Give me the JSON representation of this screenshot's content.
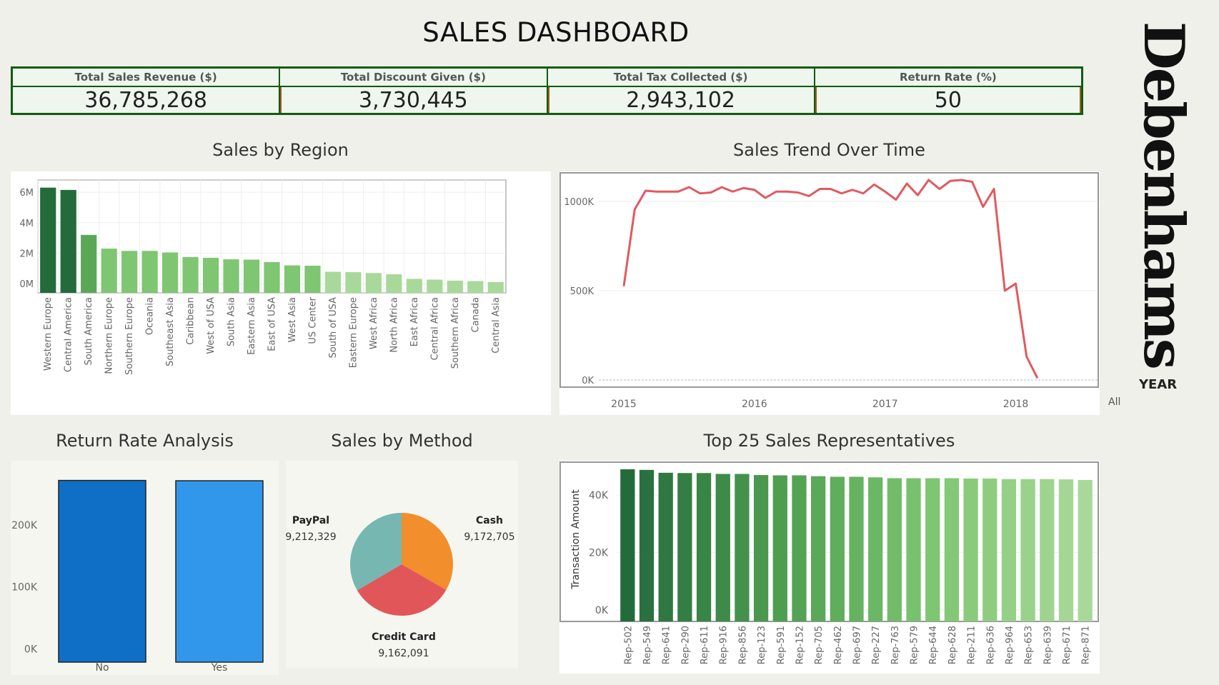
{
  "dashboard": {
    "title": "SALES DASHBOARD"
  },
  "brand": {
    "name": "Debenhams"
  },
  "filter": {
    "label": "YEAR",
    "value": "All"
  },
  "kpis": [
    {
      "label": "Total Sales Revenue ($)",
      "value": "36,785,268"
    },
    {
      "label": "Total Discount Given ($)",
      "value": "3,730,445"
    },
    {
      "label": "Total Tax Collected ($)",
      "value": "2,943,102"
    },
    {
      "label": "Return Rate (%)",
      "value": "50"
    }
  ],
  "colors": {
    "green_dark": "#246b3c",
    "green_mid": "#5aa855",
    "green_light": "#7ec671",
    "green_pale": "#a9d99a",
    "line_red": "#e05a5f",
    "blue_dark": "#0f6fc6",
    "blue_light": "#3197ea",
    "pie_orange": "#f28e2b",
    "pie_red": "#e15759",
    "pie_teal": "#76b7b2"
  },
  "chart_data": [
    {
      "id": "sales_by_region",
      "type": "bar",
      "title": "Sales by Region",
      "xlabel": "",
      "ylabel": "",
      "categories": [
        "Western Europe",
        "Central America",
        "South America",
        "Northern Europe",
        "Southern Europe",
        "Oceania",
        "Southeast Asia",
        "Caribbean",
        "West of USA",
        "South Asia",
        "Eastern Asia",
        "East of USA",
        "West Asia",
        "US Center",
        "South of USA",
        "Eastern Europe",
        "West Africa",
        "North Africa",
        "East Africa",
        "Central Africa",
        "Southern Africa",
        "Canada",
        "Central Asia"
      ],
      "values": [
        6300000,
        6150000,
        3200000,
        2300000,
        2150000,
        2150000,
        2050000,
        1750000,
        1700000,
        1600000,
        1580000,
        1420000,
        1200000,
        1180000,
        780000,
        760000,
        700000,
        620000,
        320000,
        270000,
        200000,
        170000,
        110000
      ],
      "ylim": [
        -600000,
        6800000
      ],
      "yticks": [
        0,
        2000000,
        4000000,
        6000000
      ],
      "ytick_labels": [
        "0M",
        "2M",
        "4M",
        "6M"
      ],
      "grid": true
    },
    {
      "id": "sales_trend",
      "type": "line",
      "title": "Sales Trend Over Time",
      "xlabel": "",
      "ylabel": "",
      "x": [
        "2015-01",
        "2015-02",
        "2015-03",
        "2015-04",
        "2015-05",
        "2015-06",
        "2015-07",
        "2015-08",
        "2015-09",
        "2015-10",
        "2015-11",
        "2015-12",
        "2016-01",
        "2016-02",
        "2016-03",
        "2016-04",
        "2016-05",
        "2016-06",
        "2016-07",
        "2016-08",
        "2016-09",
        "2016-10",
        "2016-11",
        "2016-12",
        "2017-01",
        "2017-02",
        "2017-03",
        "2017-04",
        "2017-05",
        "2017-06",
        "2017-07",
        "2017-08",
        "2017-09",
        "2017-10",
        "2017-11",
        "2017-12",
        "2018-01",
        "2018-02",
        "2018-03"
      ],
      "y": [
        525000,
        955000,
        1060000,
        1055000,
        1055000,
        1055000,
        1080000,
        1045000,
        1050000,
        1080000,
        1055000,
        1075000,
        1065000,
        1020000,
        1055000,
        1055000,
        1050000,
        1030000,
        1070000,
        1070000,
        1045000,
        1065000,
        1045000,
        1095000,
        1055000,
        1010000,
        1100000,
        1035000,
        1120000,
        1070000,
        1115000,
        1120000,
        1110000,
        970000,
        1070000,
        500000,
        540000,
        130000,
        10000
      ],
      "xtick_labels": [
        "2015",
        "2016",
        "2017",
        "2018"
      ],
      "yticks": [
        0,
        500000,
        1000000
      ],
      "ytick_labels": [
        "0K",
        "500K",
        "1000K"
      ],
      "ylim": [
        -40000,
        1160000
      ],
      "grid": true
    },
    {
      "id": "return_rate",
      "type": "bar",
      "title": "Return Rate Analysis",
      "xlabel": "",
      "ylabel": "",
      "categories": [
        "No",
        "Yes"
      ],
      "values": [
        272000,
        271500
      ],
      "ylim": [
        -10000,
        290000
      ],
      "yticks": [
        0,
        100000,
        200000
      ],
      "ytick_labels": [
        "0K",
        "100K",
        "200K"
      ]
    },
    {
      "id": "sales_by_method",
      "type": "pie",
      "title": "Sales by Method",
      "categories": [
        "Cash",
        "Credit Card",
        "PayPal"
      ],
      "values": [
        9172705,
        9162091,
        9212329
      ],
      "value_labels": [
        "9,172,705",
        "9,162,091",
        "9,212,329"
      ]
    },
    {
      "id": "top_reps",
      "type": "bar",
      "title": "Top 25 Sales Representatives",
      "xlabel": "",
      "ylabel": "Transaction Amount",
      "categories": [
        "Rep-502",
        "Rep-549",
        "Rep-641",
        "Rep-290",
        "Rep-611",
        "Rep-916",
        "Rep-856",
        "Rep-123",
        "Rep-591",
        "Rep-152",
        "Rep-705",
        "Rep-462",
        "Rep-697",
        "Rep-227",
        "Rep-763",
        "Rep-579",
        "Rep-644",
        "Rep-628",
        "Rep-211",
        "Rep-636",
        "Rep-964",
        "Rep-653",
        "Rep-639",
        "Rep-671",
        "Rep-871"
      ],
      "values": [
        49000,
        48800,
        47800,
        47700,
        47700,
        47400,
        47400,
        47000,
        46900,
        46900,
        46600,
        46400,
        46400,
        46200,
        45900,
        45900,
        45900,
        45900,
        45800,
        45800,
        45600,
        45600,
        45600,
        45500,
        45300
      ],
      "ylim": [
        -4000,
        51000
      ],
      "yticks": [
        0,
        20000,
        40000
      ],
      "ytick_labels": [
        "0K",
        "20K",
        "40K"
      ]
    }
  ]
}
